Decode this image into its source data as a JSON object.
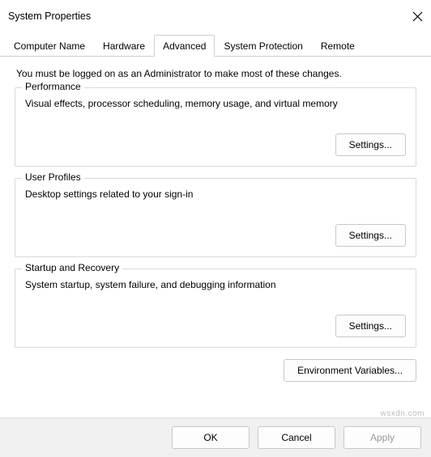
{
  "window": {
    "title": "System Properties"
  },
  "tabs": [
    {
      "label": "Computer Name"
    },
    {
      "label": "Hardware"
    },
    {
      "label": "Advanced"
    },
    {
      "label": "System Protection"
    },
    {
      "label": "Remote"
    }
  ],
  "active_tab_index": 2,
  "intro": "You must be logged on as an Administrator to make most of these changes.",
  "groups": {
    "performance": {
      "legend": "Performance",
      "desc": "Visual effects, processor scheduling, memory usage, and virtual memory",
      "button": "Settings..."
    },
    "user_profiles": {
      "legend": "User Profiles",
      "desc": "Desktop settings related to your sign-in",
      "button": "Settings..."
    },
    "startup_recovery": {
      "legend": "Startup and Recovery",
      "desc": "System startup, system failure, and debugging information",
      "button": "Settings..."
    }
  },
  "env_button": "Environment Variables...",
  "buttons": {
    "ok": "OK",
    "cancel": "Cancel",
    "apply": "Apply"
  },
  "watermark": "wsxdn.com"
}
